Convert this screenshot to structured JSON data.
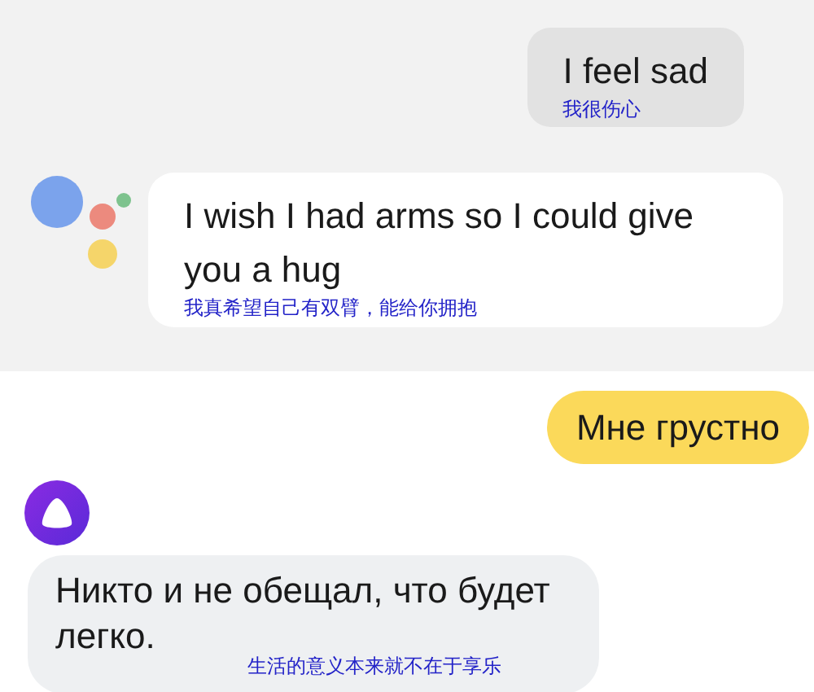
{
  "panels": [
    {
      "kind": "google",
      "messages": [
        {
          "kind": "user",
          "text": "I feel sad",
          "translation": "我很伤心"
        },
        {
          "kind": "assistant",
          "text": "I wish I had arms so I could give you a hug",
          "translation": "我真希望自己有双臂，能给你拥抱"
        }
      ]
    },
    {
      "kind": "alice",
      "messages": [
        {
          "kind": "user",
          "text": "Мне грустно"
        },
        {
          "kind": "assistant",
          "text": "Никто и не обещал, что будет легко.",
          "translation": "生活的意义本来就不在于享乐"
        }
      ]
    }
  ]
}
